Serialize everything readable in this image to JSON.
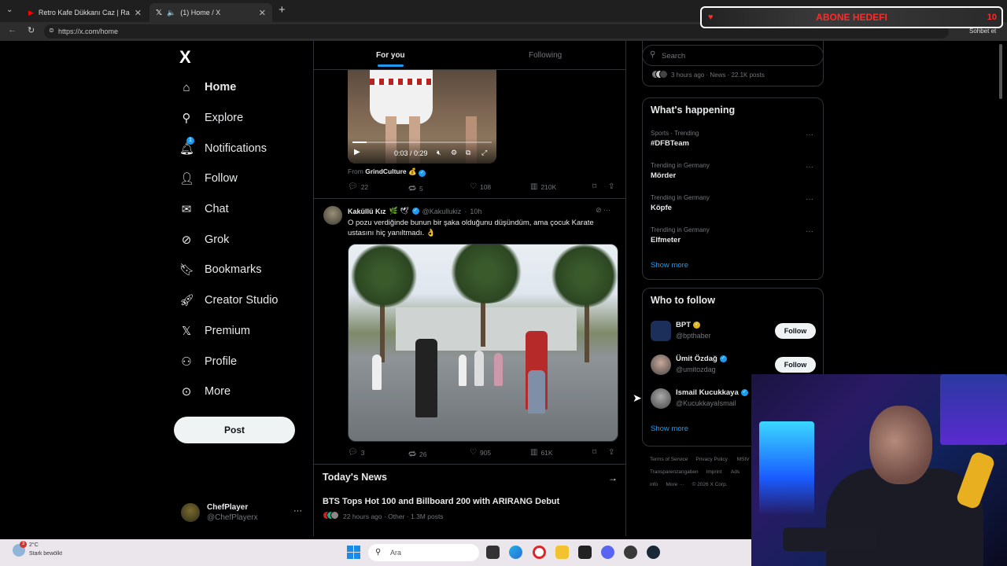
{
  "browser": {
    "tabs": [
      {
        "title": "Retro Kafe Dükkanı Caz | Rahat Bi",
        "icon": "youtube-icon"
      },
      {
        "title": "(1) Home / X",
        "icon": "x-icon"
      }
    ],
    "url": "https://x.com/home",
    "profile_label": "Sohbet et"
  },
  "stream_overlay": {
    "label": "ABONE HEDEFI",
    "count": "10"
  },
  "sidebar": {
    "logo": "X",
    "items": [
      {
        "label": "Home",
        "icon": "home-icon"
      },
      {
        "label": "Explore",
        "icon": "search-icon"
      },
      {
        "label": "Notifications",
        "icon": "bell-icon",
        "badge": "1"
      },
      {
        "label": "Follow",
        "icon": "follow-icon"
      },
      {
        "label": "Chat",
        "icon": "mail-icon"
      },
      {
        "label": "Grok",
        "icon": "grok-icon"
      },
      {
        "label": "Bookmarks",
        "icon": "bookmark-icon"
      },
      {
        "label": "Creator Studio",
        "icon": "rocket-icon"
      },
      {
        "label": "Premium",
        "icon": "x-icon"
      },
      {
        "label": "Profile",
        "icon": "person-icon"
      },
      {
        "label": "More",
        "icon": "more-circle-icon"
      }
    ],
    "post_label": "Post",
    "account": {
      "name": "ChefPlayer",
      "handle": "@ChefPlayerx"
    }
  },
  "feed": {
    "tabs": [
      "For you",
      "Following"
    ],
    "tweet1": {
      "video_time": "0:03 / 0:29",
      "video_progress": 0.1,
      "from_label": "From",
      "from_name": "GrindCulture",
      "from_emoji": "💰",
      "replies": "22",
      "reposts": "5",
      "likes": "108",
      "views": "210K"
    },
    "tweet2": {
      "name": "Kaküllü Kız",
      "name_emoji": "🌿 🕊",
      "handle": "@Kakullukiz",
      "time": "10h",
      "text": "O pozu verdiğinde bunun bir şaka olduğunu düşündüm, ama çocuk Karate ustasını hiç yanıltmadı. 👌",
      "replies": "3",
      "reposts": "26",
      "likes": "905",
      "views": "61K"
    },
    "todays_news": {
      "title": "Today's News",
      "headline": "BTS Tops Hot 100 and Billboard 200 with ARIRANG Debut",
      "meta": "22 hours ago · Other · 1.3M posts"
    }
  },
  "right": {
    "search_placeholder": "Search",
    "news_meta": "3 hours ago · News · 22.1K posts",
    "whats_happening": {
      "title": "What's happening",
      "trends": [
        {
          "context": "Sports · Trending",
          "name": "#DFBTeam"
        },
        {
          "context": "Trending in Germany",
          "name": "Mörder"
        },
        {
          "context": "Trending in Germany",
          "name": "Köpfe"
        },
        {
          "context": "Trending in Germany",
          "name": "Elfmeter"
        }
      ],
      "show_more": "Show more"
    },
    "who_to_follow": {
      "title": "Who to follow",
      "accounts": [
        {
          "name": "BPT",
          "handle": "@bpthaber",
          "badge": "gold",
          "button": "Follow"
        },
        {
          "name": "Ümit Özdağ",
          "handle": "@umitozdag",
          "badge": "blue",
          "button": "Follow"
        },
        {
          "name": "Ismail Kucukkaya",
          "handle": "@KucukkayaIsmail",
          "badge": "blue"
        }
      ],
      "show_more": "Show more"
    },
    "footer": [
      "Terms of Service",
      "Privacy Policy",
      "MStV Transparenzangaben",
      "Imprint",
      "Ads info",
      "More ···",
      "© 2026 X Corp."
    ]
  },
  "taskbar": {
    "weather_temp": "2°C",
    "weather_desc": "Stark bewölkt",
    "weather_badge": "3",
    "search_placeholder": "Ara"
  }
}
